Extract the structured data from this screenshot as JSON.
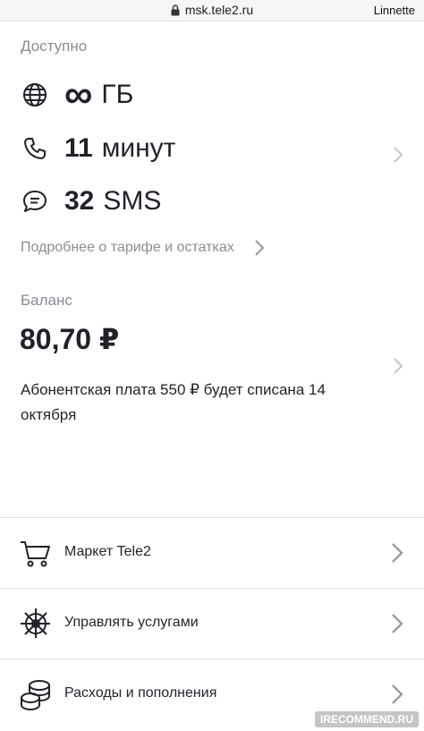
{
  "browser": {
    "url": "msk.tele2.ru",
    "reader_label": "Linnette"
  },
  "remains": {
    "label": "Доступно",
    "internet": {
      "value": "∞",
      "unit": "ГБ",
      "icon": "globe-icon"
    },
    "calls": {
      "value": "11",
      "unit": "минут",
      "icon": "phone-icon"
    },
    "sms": {
      "value": "32",
      "unit": "SMS",
      "icon": "message-icon"
    },
    "details_link": "Подробнее о тарифе и остатках"
  },
  "balance": {
    "label": "Баланс",
    "amount": "80,70 ₽",
    "fee_note": "Абонентская плата 550 ₽ будет списана 14 октября"
  },
  "menu": [
    {
      "label": "Маркет Tele2",
      "icon": "cart-icon"
    },
    {
      "label": "Управлять услугами",
      "icon": "helm-icon"
    },
    {
      "label": "Расходы и пополнения",
      "icon": "coins-icon"
    }
  ],
  "watermark": "IRECOMMEND.RU",
  "colors": {
    "text": "#1f2229",
    "muted": "#888b92",
    "chevron": "#c5c7cb",
    "divider": "#dddddd"
  }
}
